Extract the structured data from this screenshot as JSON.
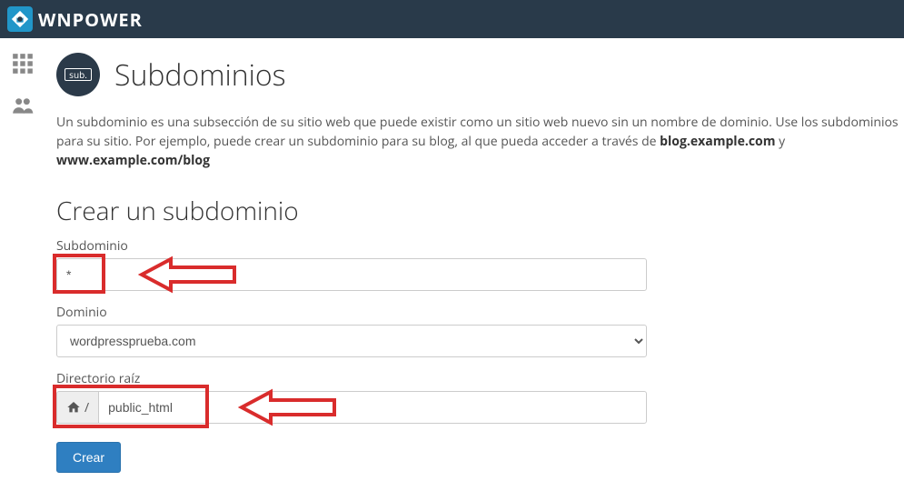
{
  "brand": {
    "name": "WNPOWER"
  },
  "page": {
    "icon_label": "sub.",
    "title": "Subdominios",
    "intro_text_1": "Un subdominio es una subsección de su sitio web que puede existir como un sitio web nuevo sin un nombre de dominio. Use los subdominios para su sitio. Por ejemplo, puede crear un subdominio para su blog, al que pueda acceder a través de ",
    "intro_bold_1": "blog.example.com",
    "intro_text_2": " y ",
    "intro_bold_2": "www.example.com/blog"
  },
  "form": {
    "section_title": "Crear un subdominio",
    "subdomain_label": "Subdominio",
    "subdomain_value": "*",
    "domain_label": "Dominio",
    "domain_value": "wordpressprueba.com",
    "docroot_label": "Directorio raíz",
    "docroot_prefix": "/",
    "docroot_value": "public_html",
    "submit_label": "Crear"
  }
}
